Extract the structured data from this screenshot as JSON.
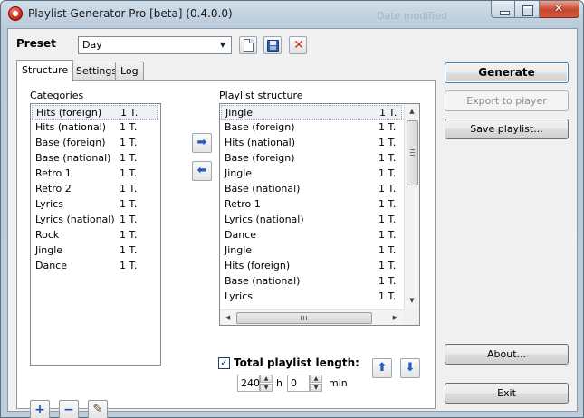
{
  "window": {
    "title": "Playlist Generator Pro [beta] (0.4.0.0)",
    "background_title": "Date modified",
    "controls": [
      "minimize",
      "maximize",
      "close"
    ]
  },
  "preset": {
    "label": "Preset",
    "selected": "Day",
    "actions": [
      "new-preset-icon",
      "save-preset-icon",
      "delete-preset-icon"
    ]
  },
  "tabs": [
    {
      "label": "Structure",
      "active": true
    },
    {
      "label": "Settings",
      "active": false
    },
    {
      "label": "Log",
      "active": false
    }
  ],
  "categories": {
    "label": "Categories",
    "items": [
      {
        "name": "Hits (foreign)",
        "count": "1 T."
      },
      {
        "name": "Hits (national)",
        "count": "1 T."
      },
      {
        "name": "Base (foreign)",
        "count": "1 T."
      },
      {
        "name": "Base (national)",
        "count": "1 T."
      },
      {
        "name": "Retro 1",
        "count": "1 T."
      },
      {
        "name": "Retro 2",
        "count": "1 T."
      },
      {
        "name": "Lyrics",
        "count": "1 T."
      },
      {
        "name": "Lyrics (national)",
        "count": "1 T."
      },
      {
        "name": "Rock",
        "count": "1 T."
      },
      {
        "name": "Jingle",
        "count": "1 T."
      },
      {
        "name": "Dance",
        "count": "1 T."
      }
    ]
  },
  "structure": {
    "label": "Playlist structure",
    "items": [
      {
        "name": "Jingle",
        "count": "1 T."
      },
      {
        "name": "Base (foreign)",
        "count": "1 T."
      },
      {
        "name": "Hits (national)",
        "count": "1 T."
      },
      {
        "name": "Base (foreign)",
        "count": "1 T."
      },
      {
        "name": "Jingle",
        "count": "1 T."
      },
      {
        "name": "Base (national)",
        "count": "1 T."
      },
      {
        "name": "Retro 1",
        "count": "1 T."
      },
      {
        "name": "Lyrics (national)",
        "count": "1 T."
      },
      {
        "name": "Dance",
        "count": "1 T."
      },
      {
        "name": "Jingle",
        "count": "1 T."
      },
      {
        "name": "Hits (foreign)",
        "count": "1 T."
      },
      {
        "name": "Base (national)",
        "count": "1 T."
      },
      {
        "name": "Lyrics",
        "count": "1 T."
      }
    ]
  },
  "length": {
    "checked": true,
    "label": "Total playlist length:",
    "hours": "240",
    "hours_unit": "h",
    "minutes": "0",
    "minutes_unit": "min"
  },
  "actions": {
    "generate": "Generate",
    "export": "Export to player",
    "save": "Save playlist...",
    "about": "About...",
    "exit": "Exit"
  },
  "glyphs": {
    "combo_arrow": "▼",
    "add": "+",
    "remove": "−",
    "edit": "✎",
    "move_right": "➡",
    "move_left": "⬅",
    "move_up": "⬆",
    "move_down": "⬇",
    "check": "✓",
    "scroll_up": "▲",
    "scroll_down": "▼",
    "scroll_left": "◀",
    "scroll_right": "▶",
    "delete": "✕"
  }
}
